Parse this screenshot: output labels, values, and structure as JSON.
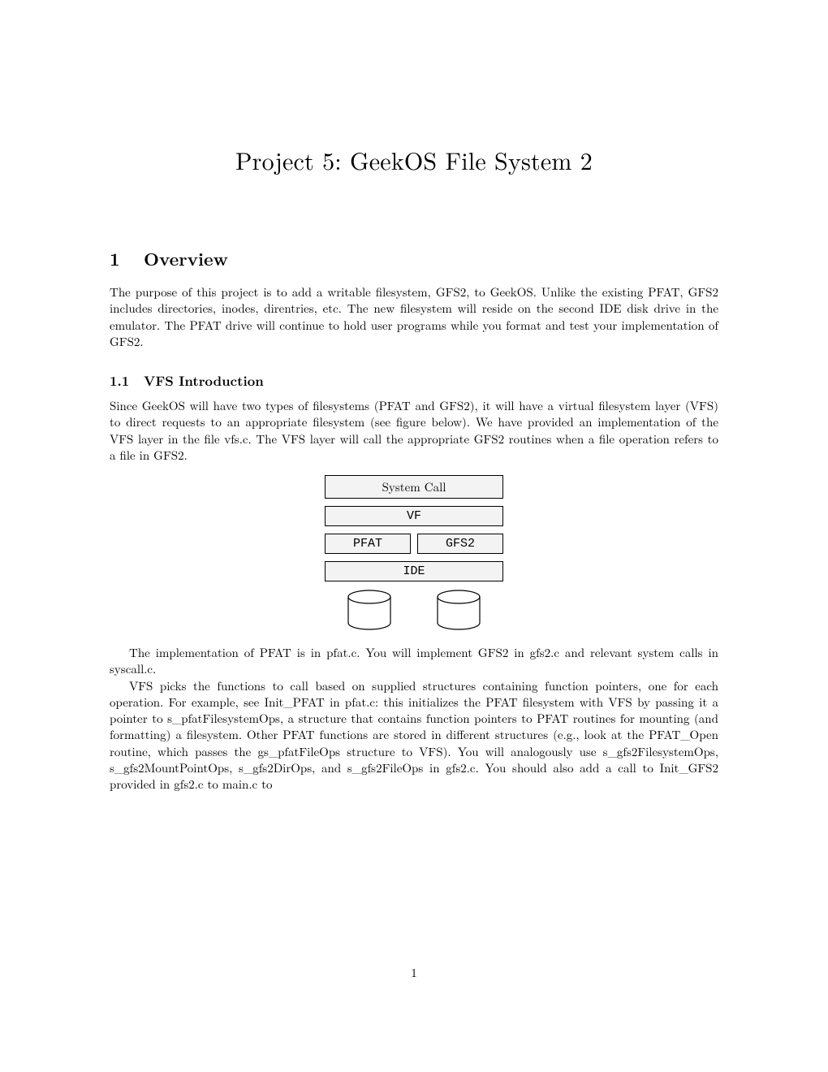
{
  "title": "Project 5: GeekOS File System 2",
  "section1": {
    "number": "1",
    "heading": "Overview",
    "p1": "The purpose of this project is to add a writable filesystem, GFS2, to GeekOS. Unlike the existing PFAT, GFS2 includes directories, inodes, direntries, etc. The new filesystem will reside on the second IDE disk drive in the emulator. The PFAT drive will continue to hold user programs while you format and test your implementation of GFS2."
  },
  "section1_1": {
    "number": "1.1",
    "heading": "VFS Introduction",
    "p1": "Since GeekOS will have two types of filesystems (PFAT and GFS2), it will have a virtual filesystem layer (VFS) to direct requests to an appropriate filesystem (see figure below). We have provided an implementation of the VFS layer in the file vfs.c. The VFS layer will call the appropriate GFS2 routines when a file operation refers to a file in GFS2.",
    "p2": "The implementation of PFAT is in pfat.c. You will implement GFS2 in gfs2.c and relevant system calls in syscall.c.",
    "p3": "VFS picks the functions to call based on supplied structures containing function pointers, one for each operation. For example, see Init_PFAT in pfat.c: this initializes the PFAT filesystem with VFS by passing it a pointer to s_pfatFilesystemOps, a structure that contains function pointers to PFAT routines for mounting (and formatting) a filesystem. Other PFAT functions are stored in different structures (e.g., look at the PFAT_Open routine, which passes the gs_pfatFileOps structure to VFS). You will analogously use s_gfs2FilesystemOps, s_gfs2MountPointOps, s_gfs2DirOps, and s_gfs2FileOps in gfs2.c. You should also add a call to Init_GFS2 provided in gfs2.c to main.c to"
  },
  "diagram": {
    "box1": "System Call",
    "box2": "VF",
    "box3a": "PFAT",
    "box3b": "GFS2",
    "box4": "IDE"
  },
  "page_number": "1"
}
